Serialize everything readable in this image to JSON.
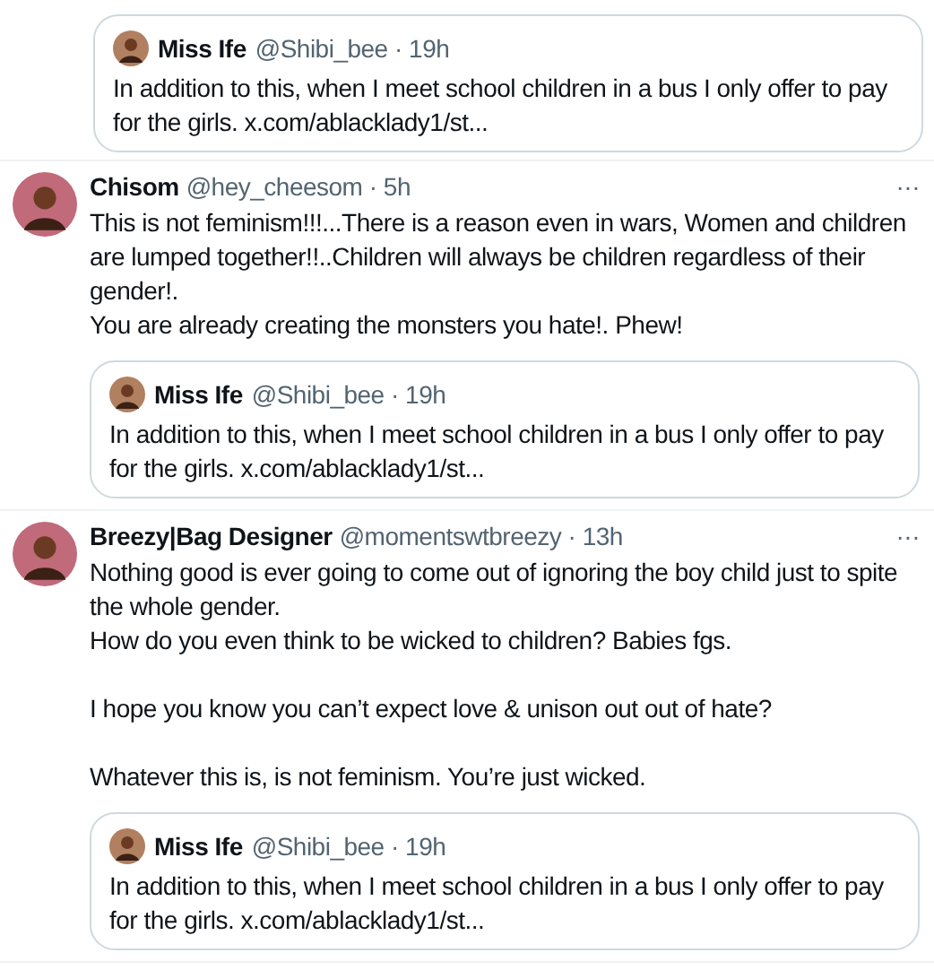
{
  "tweets": [
    {
      "quote": {
        "name": "Miss Ife",
        "meta": "@Shibi_bee · 19h",
        "text": "In addition to this, when I meet school children in a bus I only offer to pay for the girls. x.com/ablacklady1/st..."
      }
    },
    {
      "name": "Chisom",
      "meta": "@hey_cheesom · 5h",
      "more": "···",
      "text": "This is not feminism!!!...There is a reason even in wars, Women and children are lumped together!!..Children will always be children regardless of their gender!.\nYou are already creating the monsters you hate!. Phew!",
      "quote": {
        "name": "Miss Ife",
        "meta": "@Shibi_bee · 19h",
        "text": "In addition to this, when I meet school children in a bus I only offer to pay for the girls. x.com/ablacklady1/st..."
      }
    },
    {
      "name": "Breezy|Bag Designer",
      "meta": "@momentswtbreezy · 13h",
      "more": "···",
      "text": "Nothing good is ever going to come out of ignoring the boy child just to spite the whole gender.\nHow do you even think to be wicked to children? Babies fgs.\n\nI hope you know you can’t expect love & unison out out of hate?\n\nWhatever this is, is not feminism. You’re just wicked.",
      "quote": {
        "name": "Miss Ife",
        "meta": "@Shibi_bee · 19h",
        "text": "In addition to this, when I meet school children in a bus I only offer to pay for the girls. x.com/ablacklady1/st..."
      }
    }
  ]
}
